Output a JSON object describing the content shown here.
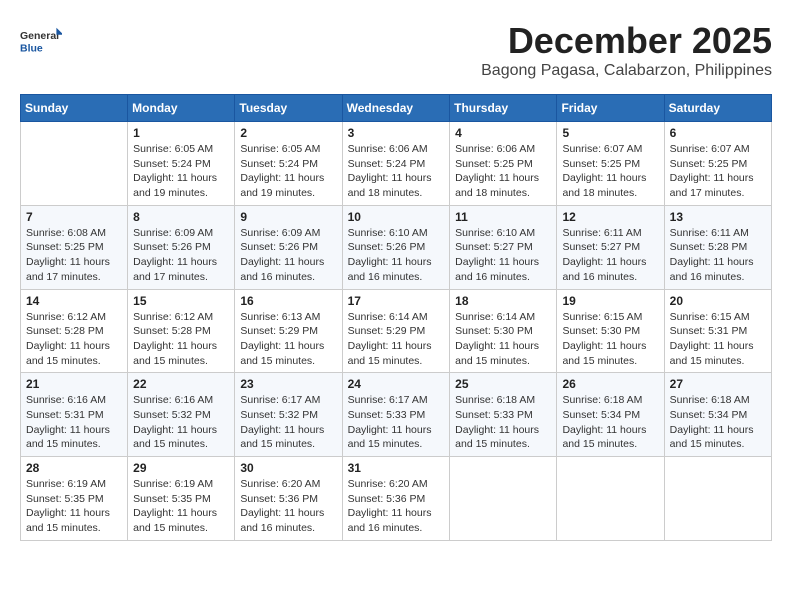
{
  "logo": {
    "general": "General",
    "blue": "Blue"
  },
  "header": {
    "month": "December 2025",
    "location": "Bagong Pagasa, Calabarzon, Philippines"
  },
  "weekdays": [
    "Sunday",
    "Monday",
    "Tuesday",
    "Wednesday",
    "Thursday",
    "Friday",
    "Saturday"
  ],
  "weeks": [
    [
      {
        "day": "",
        "info": ""
      },
      {
        "day": "1",
        "info": "Sunrise: 6:05 AM\nSunset: 5:24 PM\nDaylight: 11 hours\nand 19 minutes."
      },
      {
        "day": "2",
        "info": "Sunrise: 6:05 AM\nSunset: 5:24 PM\nDaylight: 11 hours\nand 19 minutes."
      },
      {
        "day": "3",
        "info": "Sunrise: 6:06 AM\nSunset: 5:24 PM\nDaylight: 11 hours\nand 18 minutes."
      },
      {
        "day": "4",
        "info": "Sunrise: 6:06 AM\nSunset: 5:25 PM\nDaylight: 11 hours\nand 18 minutes."
      },
      {
        "day": "5",
        "info": "Sunrise: 6:07 AM\nSunset: 5:25 PM\nDaylight: 11 hours\nand 18 minutes."
      },
      {
        "day": "6",
        "info": "Sunrise: 6:07 AM\nSunset: 5:25 PM\nDaylight: 11 hours\nand 17 minutes."
      }
    ],
    [
      {
        "day": "7",
        "info": "Sunrise: 6:08 AM\nSunset: 5:25 PM\nDaylight: 11 hours\nand 17 minutes."
      },
      {
        "day": "8",
        "info": "Sunrise: 6:09 AM\nSunset: 5:26 PM\nDaylight: 11 hours\nand 17 minutes."
      },
      {
        "day": "9",
        "info": "Sunrise: 6:09 AM\nSunset: 5:26 PM\nDaylight: 11 hours\nand 16 minutes."
      },
      {
        "day": "10",
        "info": "Sunrise: 6:10 AM\nSunset: 5:26 PM\nDaylight: 11 hours\nand 16 minutes."
      },
      {
        "day": "11",
        "info": "Sunrise: 6:10 AM\nSunset: 5:27 PM\nDaylight: 11 hours\nand 16 minutes."
      },
      {
        "day": "12",
        "info": "Sunrise: 6:11 AM\nSunset: 5:27 PM\nDaylight: 11 hours\nand 16 minutes."
      },
      {
        "day": "13",
        "info": "Sunrise: 6:11 AM\nSunset: 5:28 PM\nDaylight: 11 hours\nand 16 minutes."
      }
    ],
    [
      {
        "day": "14",
        "info": "Sunrise: 6:12 AM\nSunset: 5:28 PM\nDaylight: 11 hours\nand 15 minutes."
      },
      {
        "day": "15",
        "info": "Sunrise: 6:12 AM\nSunset: 5:28 PM\nDaylight: 11 hours\nand 15 minutes."
      },
      {
        "day": "16",
        "info": "Sunrise: 6:13 AM\nSunset: 5:29 PM\nDaylight: 11 hours\nand 15 minutes."
      },
      {
        "day": "17",
        "info": "Sunrise: 6:14 AM\nSunset: 5:29 PM\nDaylight: 11 hours\nand 15 minutes."
      },
      {
        "day": "18",
        "info": "Sunrise: 6:14 AM\nSunset: 5:30 PM\nDaylight: 11 hours\nand 15 minutes."
      },
      {
        "day": "19",
        "info": "Sunrise: 6:15 AM\nSunset: 5:30 PM\nDaylight: 11 hours\nand 15 minutes."
      },
      {
        "day": "20",
        "info": "Sunrise: 6:15 AM\nSunset: 5:31 PM\nDaylight: 11 hours\nand 15 minutes."
      }
    ],
    [
      {
        "day": "21",
        "info": "Sunrise: 6:16 AM\nSunset: 5:31 PM\nDaylight: 11 hours\nand 15 minutes."
      },
      {
        "day": "22",
        "info": "Sunrise: 6:16 AM\nSunset: 5:32 PM\nDaylight: 11 hours\nand 15 minutes."
      },
      {
        "day": "23",
        "info": "Sunrise: 6:17 AM\nSunset: 5:32 PM\nDaylight: 11 hours\nand 15 minutes."
      },
      {
        "day": "24",
        "info": "Sunrise: 6:17 AM\nSunset: 5:33 PM\nDaylight: 11 hours\nand 15 minutes."
      },
      {
        "day": "25",
        "info": "Sunrise: 6:18 AM\nSunset: 5:33 PM\nDaylight: 11 hours\nand 15 minutes."
      },
      {
        "day": "26",
        "info": "Sunrise: 6:18 AM\nSunset: 5:34 PM\nDaylight: 11 hours\nand 15 minutes."
      },
      {
        "day": "27",
        "info": "Sunrise: 6:18 AM\nSunset: 5:34 PM\nDaylight: 11 hours\nand 15 minutes."
      }
    ],
    [
      {
        "day": "28",
        "info": "Sunrise: 6:19 AM\nSunset: 5:35 PM\nDaylight: 11 hours\nand 15 minutes."
      },
      {
        "day": "29",
        "info": "Sunrise: 6:19 AM\nSunset: 5:35 PM\nDaylight: 11 hours\nand 15 minutes."
      },
      {
        "day": "30",
        "info": "Sunrise: 6:20 AM\nSunset: 5:36 PM\nDaylight: 11 hours\nand 16 minutes."
      },
      {
        "day": "31",
        "info": "Sunrise: 6:20 AM\nSunset: 5:36 PM\nDaylight: 11 hours\nand 16 minutes."
      },
      {
        "day": "",
        "info": ""
      },
      {
        "day": "",
        "info": ""
      },
      {
        "day": "",
        "info": ""
      }
    ]
  ]
}
